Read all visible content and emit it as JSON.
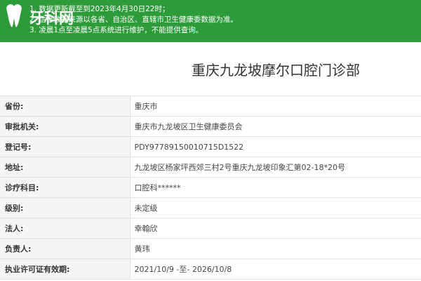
{
  "colors": {
    "banner": "#2e9b3a",
    "label_bg": "#f5f5f5",
    "border": "#e2e2e2"
  },
  "logo": {
    "icon": "logo-icon",
    "text": "牙科网"
  },
  "notice": [
    "1. 数据更新截至到2023年4月30日22时；",
    "2. 信息数据来源以各省、自治区、直辖市卫生健康委数据为准。",
    "3. 凌晨1点至凌晨5点系统进行维护，不能提供查询。"
  ],
  "title": "重庆九龙坡摩尔口腔门诊部",
  "rows": [
    {
      "label": "省份:",
      "value": "重庆市"
    },
    {
      "label": "审批机关:",
      "value": "重庆市九龙坡区卫生健康委员会"
    },
    {
      "label": "登记号:",
      "value": "PDY97789150010715D1522"
    },
    {
      "label": "地址:",
      "value": "九龙坡区杨家坪西郊三村2号重庆九龙坡印象汇第02-18*20号"
    },
    {
      "label": "诊疗科目:",
      "value": "口腔科******"
    },
    {
      "label": "级别:",
      "value": "未定级"
    },
    {
      "label": "法人:",
      "value": "幸翰欣"
    },
    {
      "label": "负责人:",
      "value": "黄玮"
    },
    {
      "label": "执业许可证有效期:",
      "value": "2021/10/9 -至- 2026/10/8"
    }
  ]
}
